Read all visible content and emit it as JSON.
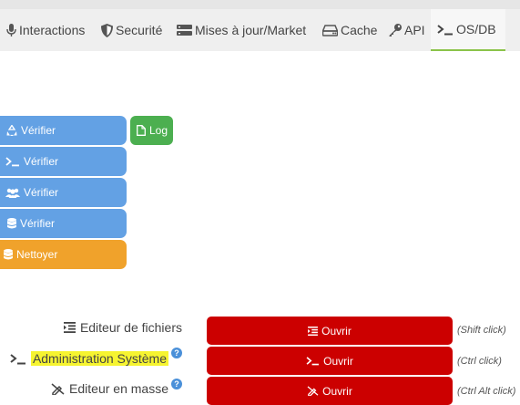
{
  "tabs": [
    {
      "label": "Interactions",
      "icon": "microphone-icon"
    },
    {
      "label": "Securité",
      "icon": "shield-icon"
    },
    {
      "label": "Mises à jour/Market",
      "icon": "server-icon"
    },
    {
      "label": "Cache",
      "icon": "hard-drive-icon"
    },
    {
      "label": "API",
      "icon": "key-icon"
    },
    {
      "label": "OS/DB",
      "icon": "terminal-icon",
      "active": true
    }
  ],
  "actions": {
    "verify_1": "Vérifier",
    "log": "Log",
    "verify_2": "Vérifier",
    "verify_3": "Vérifier",
    "verify_4": "Vérifier",
    "clean": "Nettoyer"
  },
  "rows": [
    {
      "label": "Editeur de fichiers",
      "button": "Ouvrir",
      "hint": "(Shift click)"
    },
    {
      "label": "Administration Système",
      "button": "Ouvrir",
      "hint": "(Ctrl click)"
    },
    {
      "label": "Editeur en masse",
      "button": "Ouvrir",
      "hint": "(Ctrl Alt click)"
    }
  ],
  "colors": {
    "blue": "#63a1e4",
    "green": "#4caf50",
    "orange": "#f0a22b",
    "red": "#cc0000",
    "highlight": "#f6f430",
    "tab_accent": "#8bc34a"
  }
}
